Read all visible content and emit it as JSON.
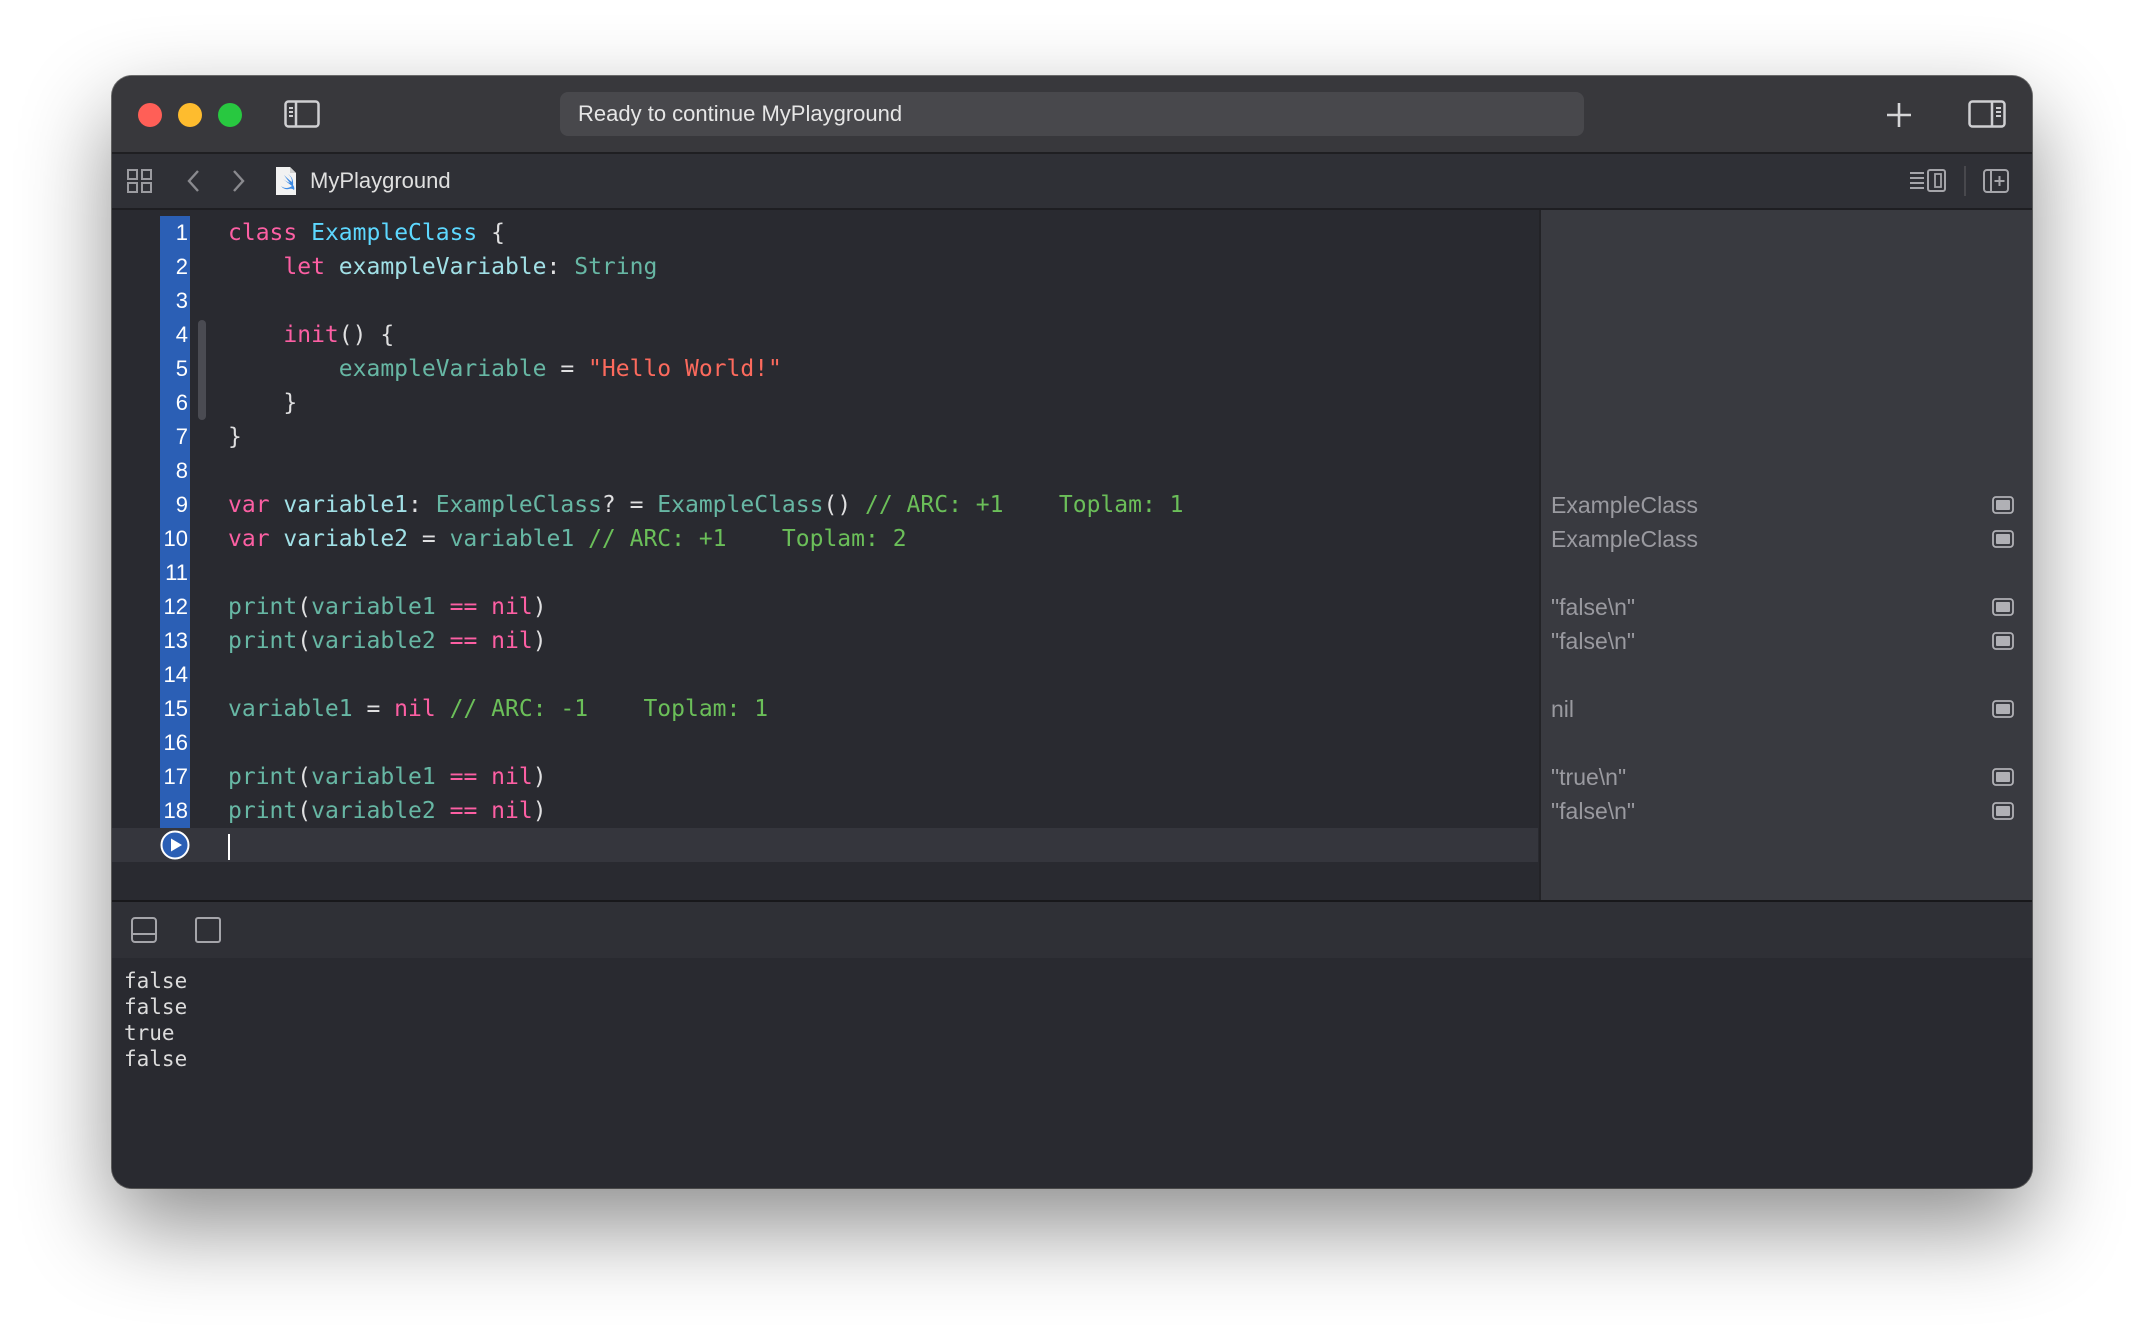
{
  "window": {
    "status": "Ready to continue MyPlayground",
    "file_name": "MyPlayground"
  },
  "editor": {
    "lines": [
      {
        "n": "1",
        "tokens": [
          [
            "kw",
            "class"
          ],
          [
            "pl",
            " "
          ],
          [
            "ty",
            "ExampleClass"
          ],
          [
            "pl",
            " {"
          ]
        ]
      },
      {
        "n": "2",
        "tokens": [
          [
            "pl",
            "    "
          ],
          [
            "kw",
            "let"
          ],
          [
            "pl",
            " "
          ],
          [
            "id",
            "exampleVariable"
          ],
          [
            "pl",
            ": "
          ],
          [
            "ty2",
            "String"
          ]
        ]
      },
      {
        "n": "3",
        "tokens": []
      },
      {
        "n": "4",
        "tokens": [
          [
            "pl",
            "    "
          ],
          [
            "kw",
            "init"
          ],
          [
            "pl",
            "() {"
          ]
        ]
      },
      {
        "n": "5",
        "tokens": [
          [
            "pl",
            "        "
          ],
          [
            "id2",
            "exampleVariable"
          ],
          [
            "pl",
            " = "
          ],
          [
            "str",
            "\"Hello World!\""
          ]
        ]
      },
      {
        "n": "6",
        "tokens": [
          [
            "pl",
            "    }"
          ]
        ]
      },
      {
        "n": "7",
        "tokens": [
          [
            "pl",
            "}"
          ]
        ]
      },
      {
        "n": "8",
        "tokens": []
      },
      {
        "n": "9",
        "tokens": [
          [
            "kw",
            "var"
          ],
          [
            "pl",
            " "
          ],
          [
            "id",
            "variable1"
          ],
          [
            "pl",
            ": "
          ],
          [
            "ty2",
            "ExampleClass"
          ],
          [
            "pl",
            "? = "
          ],
          [
            "ty2",
            "ExampleClass"
          ],
          [
            "pl",
            "() "
          ],
          [
            "cm",
            "// ARC: +1    Toplam: 1"
          ]
        ]
      },
      {
        "n": "10",
        "tokens": [
          [
            "kw",
            "var"
          ],
          [
            "pl",
            " "
          ],
          [
            "id",
            "variable2"
          ],
          [
            "pl",
            " = "
          ],
          [
            "id2",
            "variable1"
          ],
          [
            "pl",
            " "
          ],
          [
            "cm",
            "// ARC: +1    Toplam: 2"
          ]
        ]
      },
      {
        "n": "11",
        "tokens": []
      },
      {
        "n": "12",
        "tokens": [
          [
            "fn",
            "print"
          ],
          [
            "pl",
            "("
          ],
          [
            "id2",
            "variable1"
          ],
          [
            "pl",
            " "
          ],
          [
            "kw",
            "=="
          ],
          [
            "pl",
            " "
          ],
          [
            "kw",
            "nil"
          ],
          [
            "pl",
            ")"
          ]
        ]
      },
      {
        "n": "13",
        "tokens": [
          [
            "fn",
            "print"
          ],
          [
            "pl",
            "("
          ],
          [
            "id2",
            "variable2"
          ],
          [
            "pl",
            " "
          ],
          [
            "kw",
            "=="
          ],
          [
            "pl",
            " "
          ],
          [
            "kw",
            "nil"
          ],
          [
            "pl",
            ")"
          ]
        ]
      },
      {
        "n": "14",
        "tokens": []
      },
      {
        "n": "15",
        "tokens": [
          [
            "id2",
            "variable1"
          ],
          [
            "pl",
            " = "
          ],
          [
            "kw",
            "nil"
          ],
          [
            "pl",
            " "
          ],
          [
            "cm",
            "// ARC: -1    Toplam: 1"
          ]
        ]
      },
      {
        "n": "16",
        "tokens": []
      },
      {
        "n": "17",
        "tokens": [
          [
            "fn",
            "print"
          ],
          [
            "pl",
            "("
          ],
          [
            "id2",
            "variable1"
          ],
          [
            "pl",
            " "
          ],
          [
            "kw",
            "=="
          ],
          [
            "pl",
            " "
          ],
          [
            "kw",
            "nil"
          ],
          [
            "pl",
            ")"
          ]
        ]
      },
      {
        "n": "18",
        "tokens": [
          [
            "fn",
            "print"
          ],
          [
            "pl",
            "("
          ],
          [
            "id2",
            "variable2"
          ],
          [
            "pl",
            " "
          ],
          [
            "kw",
            "=="
          ],
          [
            "pl",
            " "
          ],
          [
            "kw",
            "nil"
          ],
          [
            "pl",
            ")"
          ]
        ]
      }
    ]
  },
  "results": [
    {
      "line": 9,
      "value": "ExampleClass"
    },
    {
      "line": 10,
      "value": "ExampleClass"
    },
    {
      "line": 12,
      "value": "\"false\\n\""
    },
    {
      "line": 13,
      "value": "\"false\\n\""
    },
    {
      "line": 15,
      "value": "nil"
    },
    {
      "line": 17,
      "value": "\"true\\n\""
    },
    {
      "line": 18,
      "value": "\"false\\n\""
    }
  ],
  "console": {
    "lines": [
      "false",
      "false",
      "true",
      "false"
    ]
  },
  "colors": {
    "keyword": "#fc5fa3",
    "type": "#5dd8ff",
    "string": "#fc6a5d",
    "comment": "#6bbf59",
    "gutter_highlight": "#2b5fb5"
  },
  "icons": {
    "sidebar_toggle": "sidebar-left-icon",
    "add": "plus-icon",
    "inspector_toggle": "sidebar-right-icon",
    "grid": "grid-icon",
    "back": "chevron-left-icon",
    "forward": "chevron-right-icon",
    "file": "swift-file-icon",
    "editor_options": "editor-options-icon",
    "add_editor": "add-editor-icon",
    "run": "play-icon",
    "quick_look": "quick-look-icon",
    "hide_debug": "hide-debug-area-icon",
    "console_toggle": "console-toggle-icon"
  }
}
